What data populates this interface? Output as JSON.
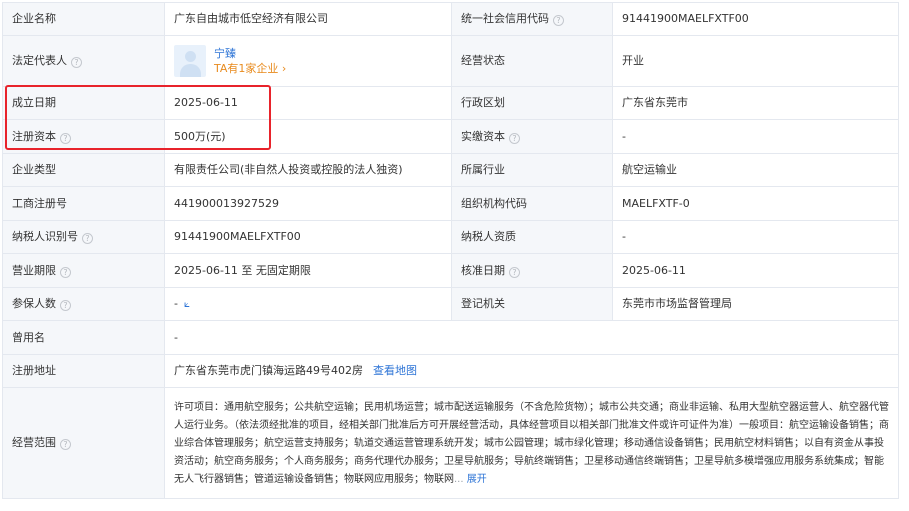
{
  "rows": {
    "r1": {
      "l1": "企业名称",
      "v1": "广东自由城市低空经济有限公司",
      "l2": "统一社会信用代码",
      "v2": "91441900MAELFXTF00"
    },
    "r2": {
      "l1": "法定代表人",
      "rep_name": "宁臻",
      "rep_tag": "TA有1家企业 ›",
      "l2": "经营状态",
      "v2": "开业"
    },
    "r3": {
      "l1": "成立日期",
      "v1": "2025-06-11",
      "l2": "行政区划",
      "v2": "广东省东莞市"
    },
    "r4": {
      "l1": "注册资本",
      "v1": "500万(元)",
      "l2": "实缴资本",
      "v2": "-"
    },
    "r5": {
      "l1": "企业类型",
      "v1": "有限责任公司(非自然人投资或控股的法人独资)",
      "l2": "所属行业",
      "v2": "航空运输业"
    },
    "r6": {
      "l1": "工商注册号",
      "v1": "441900013927529",
      "l2": "组织机构代码",
      "v2": "MAELFXTF-0"
    },
    "r7": {
      "l1": "纳税人识别号",
      "v1": "91441900MAELFXTF00",
      "l2": "纳税人资质",
      "v2": "-"
    },
    "r8": {
      "l1": "营业期限",
      "v1": "2025-06-11 至 无固定期限",
      "l2": "核准日期",
      "v2": "2025-06-11"
    },
    "r9": {
      "l1": "参保人数",
      "v1": "-",
      "l2": "登记机关",
      "v2": "东莞市市场监督管理局"
    },
    "r10": {
      "l1": "曾用名",
      "v1": "-"
    },
    "r11": {
      "l1": "注册地址",
      "v1": "广东省东莞市虎门镇海运路49号402房",
      "map_link": "查看地图"
    },
    "r12": {
      "l1": "经营范围",
      "text": "许可项目：通用航空服务；公共航空运输；民用机场运营；城市配送运输服务（不含危险货物）；城市公共交通；商业非运输、私用大型航空器运营人、航空器代管人运行业务。（依法须经批准的项目，经相关部门批准后方可开展经营活动，具体经营项目以相关部门批准文件或许可证件为准）一般项目：航空运输设备销售；商业综合体管理服务；航空运营支持服务；轨道交通运营管理系统开发；城市公园管理；城市绿化管理；移动通信设备销售；民用航空材料销售；以自有资金从事投资活动；航空商务服务；个人商务服务；商务代理代办服务；卫星导航服务；导航终端销售；卫星移动通信终端销售；卫星导航多模增强应用服务系统集成；智能无人飞行器销售；管道运输设备销售；物联网应用服务；物联网",
      "ellipsis": "...",
      "expand": "展开"
    }
  },
  "help_glyph": "?",
  "chart_icon_glyph": "⟀",
  "colors": {
    "link": "#2d74d6",
    "tag": "#e88b1e",
    "highlight": "#e8232b",
    "label_bg": "#f5f7fa"
  }
}
